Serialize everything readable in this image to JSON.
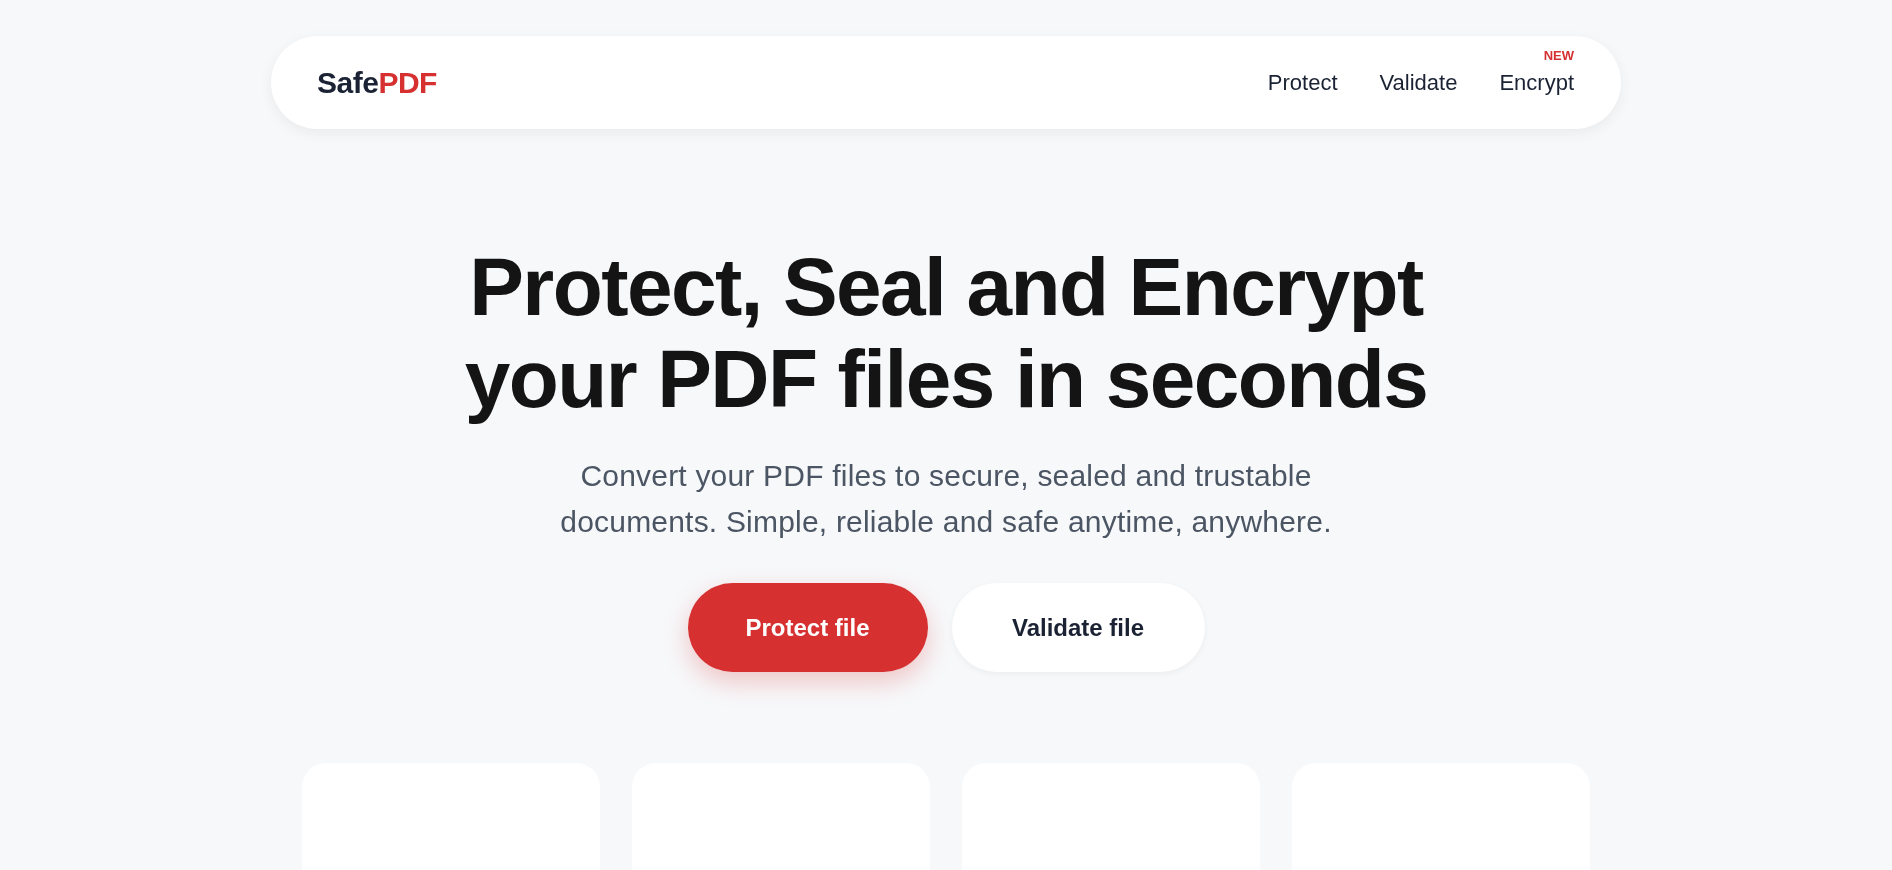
{
  "logo": {
    "text": "Safe",
    "accent": "PDF"
  },
  "nav": [
    {
      "label": "Protect"
    },
    {
      "label": "Validate"
    },
    {
      "label": "Encrypt",
      "badge": "NEW"
    }
  ],
  "hero": {
    "title_lines": [
      "Protect, Seal and Encrypt",
      "your PDF files in seconds"
    ],
    "subtitle_lines": [
      "Convert your PDF files to secure, sealed and trustable",
      "documents. Simple, reliable and safe anytime, anywhere."
    ]
  },
  "buttons": [
    {
      "label": "Protect file",
      "kind": "primary"
    },
    {
      "label": "Validate file",
      "kind": "secondary"
    }
  ],
  "cards": [
    {
      "kind": "card"
    },
    {
      "kind": "card"
    },
    {
      "kind": "card"
    },
    {
      "kind": "card"
    }
  ]
}
